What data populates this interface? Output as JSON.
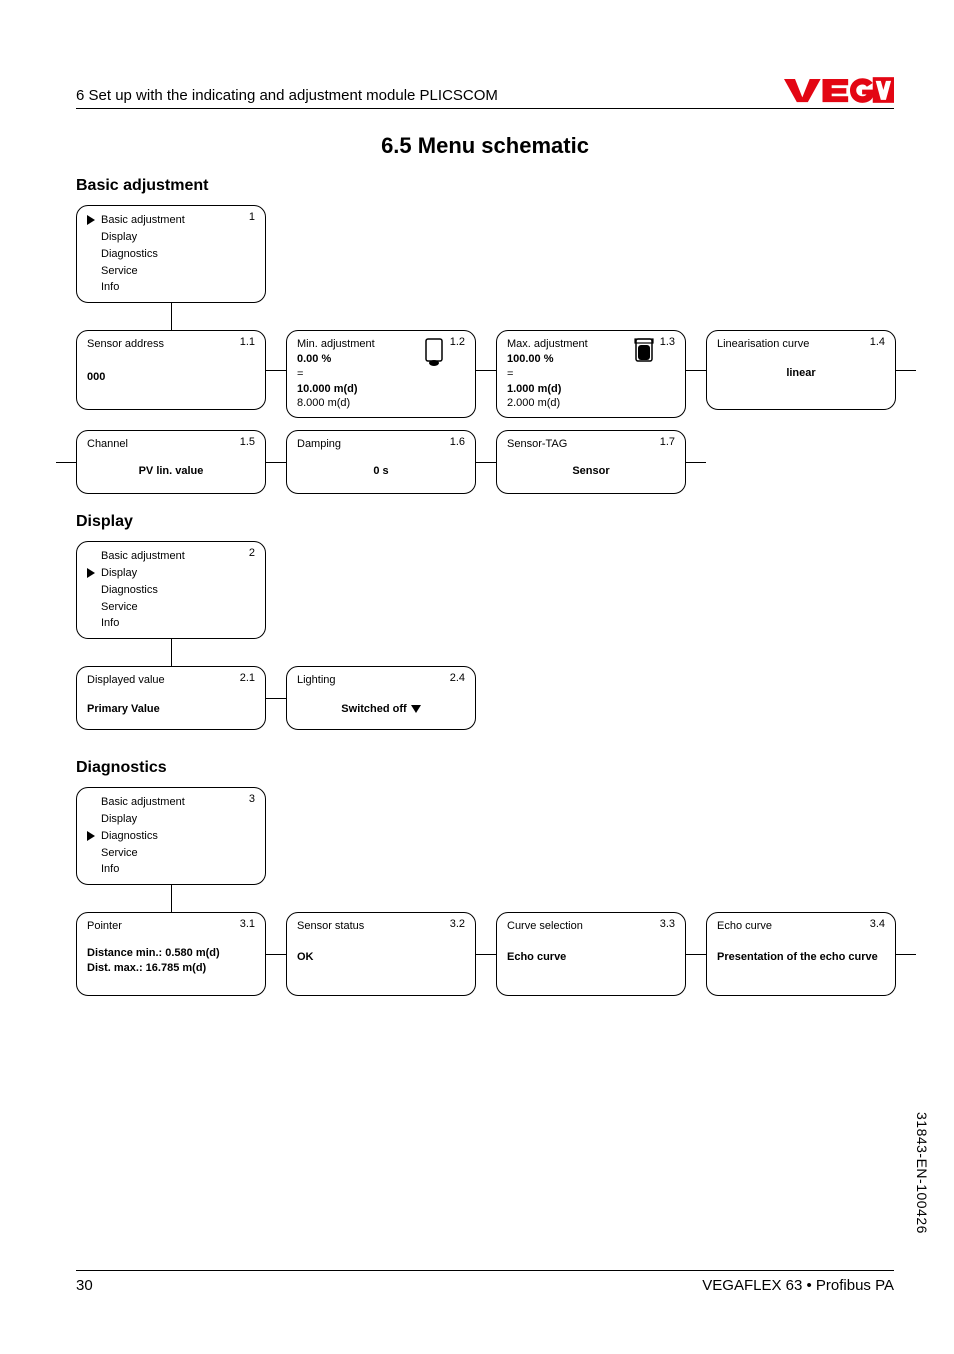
{
  "header": {
    "chapter": "6   Set up with the indicating and adjustment module PLICSCOM",
    "section_title": "6.5   Menu schematic"
  },
  "logo_name": "vega-logo",
  "sections": {
    "basic": "Basic adjustment",
    "display": "Display",
    "diagnostics": "Diagnostics"
  },
  "menu_items": {
    "basic_adjustment": "Basic adjustment",
    "display": "Display",
    "diagnostics": "Diagnostics",
    "service": "Service",
    "info": "Info"
  },
  "basic": {
    "list_num": "1",
    "n11": {
      "num": "1.1",
      "title": "Sensor address",
      "value": "000"
    },
    "n12": {
      "num": "1.2",
      "title": "Min. adjustment",
      "pct": "0.00 %",
      "eq": "=",
      "dist_bold": "10.000 m(d)",
      "dist": "8.000 m(d)"
    },
    "n13": {
      "num": "1.3",
      "title": "Max. adjustment",
      "pct": "100.00 %",
      "eq": "=",
      "dist_bold": "1.000 m(d)",
      "dist": "2.000 m(d)"
    },
    "n14": {
      "num": "1.4",
      "title": "Linearisation curve",
      "value": "linear"
    },
    "n15": {
      "num": "1.5",
      "title": "Channel",
      "value": "PV lin. value"
    },
    "n16": {
      "num": "1.6",
      "title": "Damping",
      "value": "0 s"
    },
    "n17": {
      "num": "1.7",
      "title": "Sensor-TAG",
      "value": "Sensor"
    }
  },
  "display": {
    "list_num": "2",
    "n21": {
      "num": "2.1",
      "title": "Displayed value",
      "value": "Primary Value"
    },
    "n24": {
      "num": "2.4",
      "title": "Lighting",
      "value": "Switched off"
    }
  },
  "diagnostics": {
    "list_num": "3",
    "n31": {
      "num": "3.1",
      "title": "Pointer",
      "l1": "Distance min.: 0.580 m(d)",
      "l2": "Dist. max.: 16.785 m(d)"
    },
    "n32": {
      "num": "3.2",
      "title": "Sensor status",
      "value": "OK"
    },
    "n33": {
      "num": "3.3",
      "title": "Curve selection",
      "value": "Echo curve"
    },
    "n34": {
      "num": "3.4",
      "title": "Echo curve",
      "value": "Presentation of the echo curve"
    }
  },
  "footer": {
    "page": "30",
    "doc": "VEGAFLEX 63 • Profibus PA"
  },
  "sidecode": "31843-EN-100426"
}
